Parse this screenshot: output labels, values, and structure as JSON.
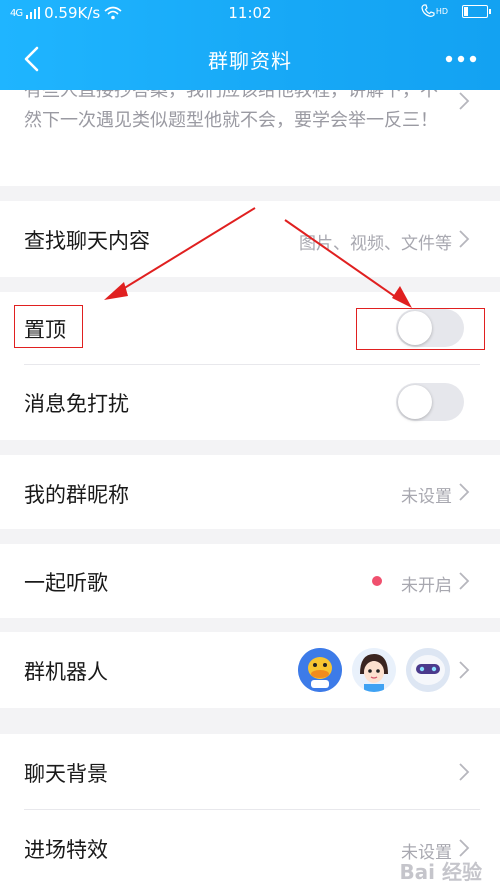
{
  "status_bar": {
    "signal": "4G",
    "network_speed": "0.59K/s",
    "time": "11:02",
    "call_badge": "HD"
  },
  "header": {
    "title": "群聊资料",
    "back_icon": "chevron-left-icon",
    "more_icon": "more-dots-icon"
  },
  "announcement": {
    "text": "有些人直接抄答案，我们应该给他教程，讲解下，不然下一次遇见类似题型他就不会，要学会举一反三！"
  },
  "settings": {
    "find_chat": {
      "label": "查找聊天内容",
      "value": "图片、视频、文件等"
    },
    "pin_top": {
      "label": "置顶",
      "enabled": false
    },
    "mute": {
      "label": "消息免打扰",
      "enabled": false
    },
    "group_nickname": {
      "label": "我的群昵称",
      "value": "未设置"
    },
    "listen_together": {
      "label": "一起听歌",
      "value": "未开启",
      "status_color": "#f0506e"
    },
    "group_robot": {
      "label": "群机器人",
      "avatars": [
        "duck-robot-avatar",
        "girl-robot-avatar",
        "white-robot-avatar"
      ]
    },
    "chat_background": {
      "label": "聊天背景"
    },
    "entrance_effect": {
      "label": "进场特效",
      "value": "未设置"
    }
  },
  "colors": {
    "header_blue": "#17a8f6",
    "annotation_red": "#e02020",
    "toggle_off": "#e6e7ec"
  },
  "watermark": "Bai 经验"
}
